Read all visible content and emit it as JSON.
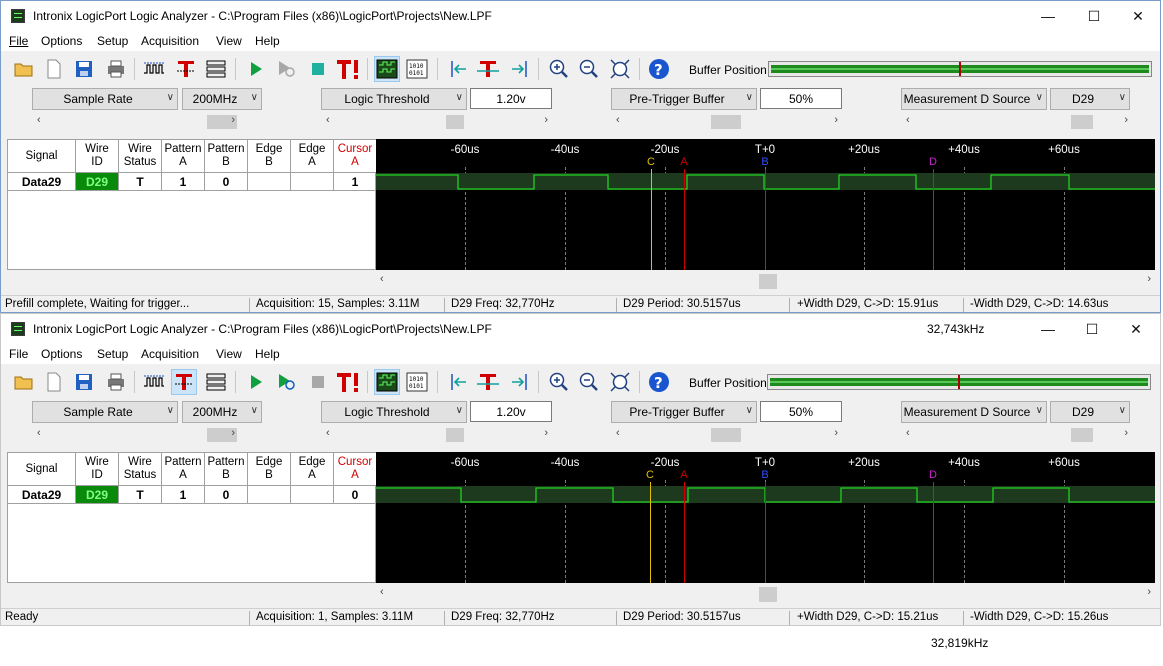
{
  "windows": [
    {
      "title": "Intronix LogicPort Logic Analyzer - C:\\Program Files (x86)\\LogicPort\\Projects\\New.LPF",
      "title_extra": "",
      "menu": [
        "File",
        "Options",
        "Setup",
        "Acquisition",
        "View",
        "Help"
      ],
      "buffer_label": "Buffer Position:",
      "buffer_position": 0.5,
      "sample_rate_label": "Sample Rate",
      "sample_rate_value": "200MHz",
      "logic_threshold_label": "Logic Threshold",
      "logic_threshold_value": "1.20v",
      "pretrigger_label": "Pre-Trigger Buffer",
      "pretrigger_value": "50%",
      "measurement_label": "Measurement D Source",
      "measurement_value": "D29",
      "grid_headers": [
        [
          "Signal"
        ],
        [
          "Wire",
          "ID"
        ],
        [
          "Wire",
          "Status"
        ],
        [
          "Pattern",
          "A"
        ],
        [
          "Pattern",
          "B"
        ],
        [
          "Edge",
          "B"
        ],
        [
          "Edge",
          "A"
        ],
        [
          "Cursor",
          "A"
        ]
      ],
      "row": {
        "signal": "Data29",
        "wire_id": "D29",
        "wire_status": "T",
        "pattern_a": "1",
        "pattern_b": "0",
        "edge_b": "",
        "edge_a": "",
        "cursor_a": "1"
      },
      "ticks": [
        "-60us",
        "-40us",
        "-20us",
        "T+0",
        "+20us",
        "+40us",
        "+60us"
      ],
      "cursors": [
        "C",
        "A",
        "B",
        "D"
      ],
      "status": [
        "Prefill complete, Waiting for trigger...",
        "Acquisition: 15, Samples: 3.11M",
        "D29 Freq: 32,770Hz",
        "D29 Period: 30.5157us",
        "+Width D29, C->D: 15.91us",
        "-Width D29, C->D: 14.63us"
      ],
      "trace_level": "high"
    },
    {
      "title": "Intronix LogicPort Logic Analyzer - C:\\Program Files (x86)\\LogicPort\\Projects\\New.LPF",
      "title_extra": "32,743kHz",
      "menu": [
        "File",
        "Options",
        "Setup",
        "Acquisition",
        "View",
        "Help"
      ],
      "buffer_label": "Buffer Position:",
      "buffer_position": 0.5,
      "sample_rate_label": "Sample Rate",
      "sample_rate_value": "200MHz",
      "logic_threshold_label": "Logic Threshold",
      "logic_threshold_value": "1.20v",
      "pretrigger_label": "Pre-Trigger Buffer",
      "pretrigger_value": "50%",
      "measurement_label": "Measurement D Source",
      "measurement_value": "D29",
      "grid_headers": [
        [
          "Signal"
        ],
        [
          "Wire",
          "ID"
        ],
        [
          "Wire",
          "Status"
        ],
        [
          "Pattern",
          "A"
        ],
        [
          "Pattern",
          "B"
        ],
        [
          "Edge",
          "B"
        ],
        [
          "Edge",
          "A"
        ],
        [
          "Cursor",
          "A"
        ]
      ],
      "row": {
        "signal": "Data29",
        "wire_id": "D29",
        "wire_status": "T",
        "pattern_a": "1",
        "pattern_b": "0",
        "edge_b": "",
        "edge_a": "",
        "cursor_a": "0"
      },
      "ticks": [
        "-60us",
        "-40us",
        "-20us",
        "T+0",
        "+20us",
        "+40us",
        "+60us"
      ],
      "cursors": [
        "C",
        "A",
        "B",
        "D"
      ],
      "status": [
        "Ready",
        "Acquisition: 1, Samples: 3.11M",
        "D29 Freq: 32,770Hz",
        "D29 Period: 30.5157us",
        "+Width D29, C->D: 15.21us",
        "-Width D29, C->D: 15.26us"
      ],
      "trace_level": "low"
    }
  ],
  "footer_text": "32,819kHz",
  "colors": {
    "cursor_c": "#e0c000",
    "cursor_a": "#d00000",
    "cursor_b": "#2040ff",
    "cursor_d": "#c000c0",
    "cursor_header": "#d00000",
    "trace": "#20d020"
  }
}
